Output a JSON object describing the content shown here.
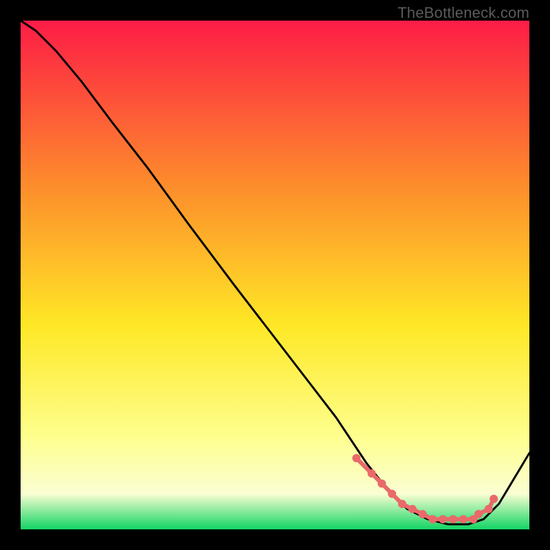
{
  "attribution": "TheBottleneck.com",
  "chart_data": {
    "type": "line",
    "title": "",
    "xlabel": "",
    "ylabel": "",
    "xlim": [
      0,
      100
    ],
    "ylim": [
      0,
      100
    ],
    "background_gradient": {
      "top": "#fd1c46",
      "upper_mid": "#fd8b2c",
      "mid": "#fee826",
      "lower_mid": "#feff8f",
      "pale": "#fafed2",
      "bottom": "#12d564"
    },
    "series": [
      {
        "name": "curve",
        "color": "#000000",
        "x": [
          0,
          3,
          7,
          12,
          18,
          25,
          33,
          42,
          52,
          62,
          68,
          72,
          76,
          80,
          84,
          88,
          91,
          94,
          100
        ],
        "y": [
          100,
          98,
          94,
          88,
          80,
          71,
          60,
          48,
          35,
          22,
          13,
          8,
          4,
          2,
          1,
          1,
          2,
          5,
          15
        ]
      }
    ],
    "marker_points": {
      "name": "highlight-dots",
      "color": "#e96a6a",
      "radius_px": 6,
      "x": [
        66,
        69,
        71,
        73,
        75,
        77,
        79,
        81,
        83,
        85,
        87,
        89,
        90,
        92,
        93
      ],
      "y": [
        14,
        11,
        9,
        7,
        5,
        4,
        3,
        2,
        2,
        2,
        2,
        2,
        3,
        4,
        6
      ]
    }
  }
}
